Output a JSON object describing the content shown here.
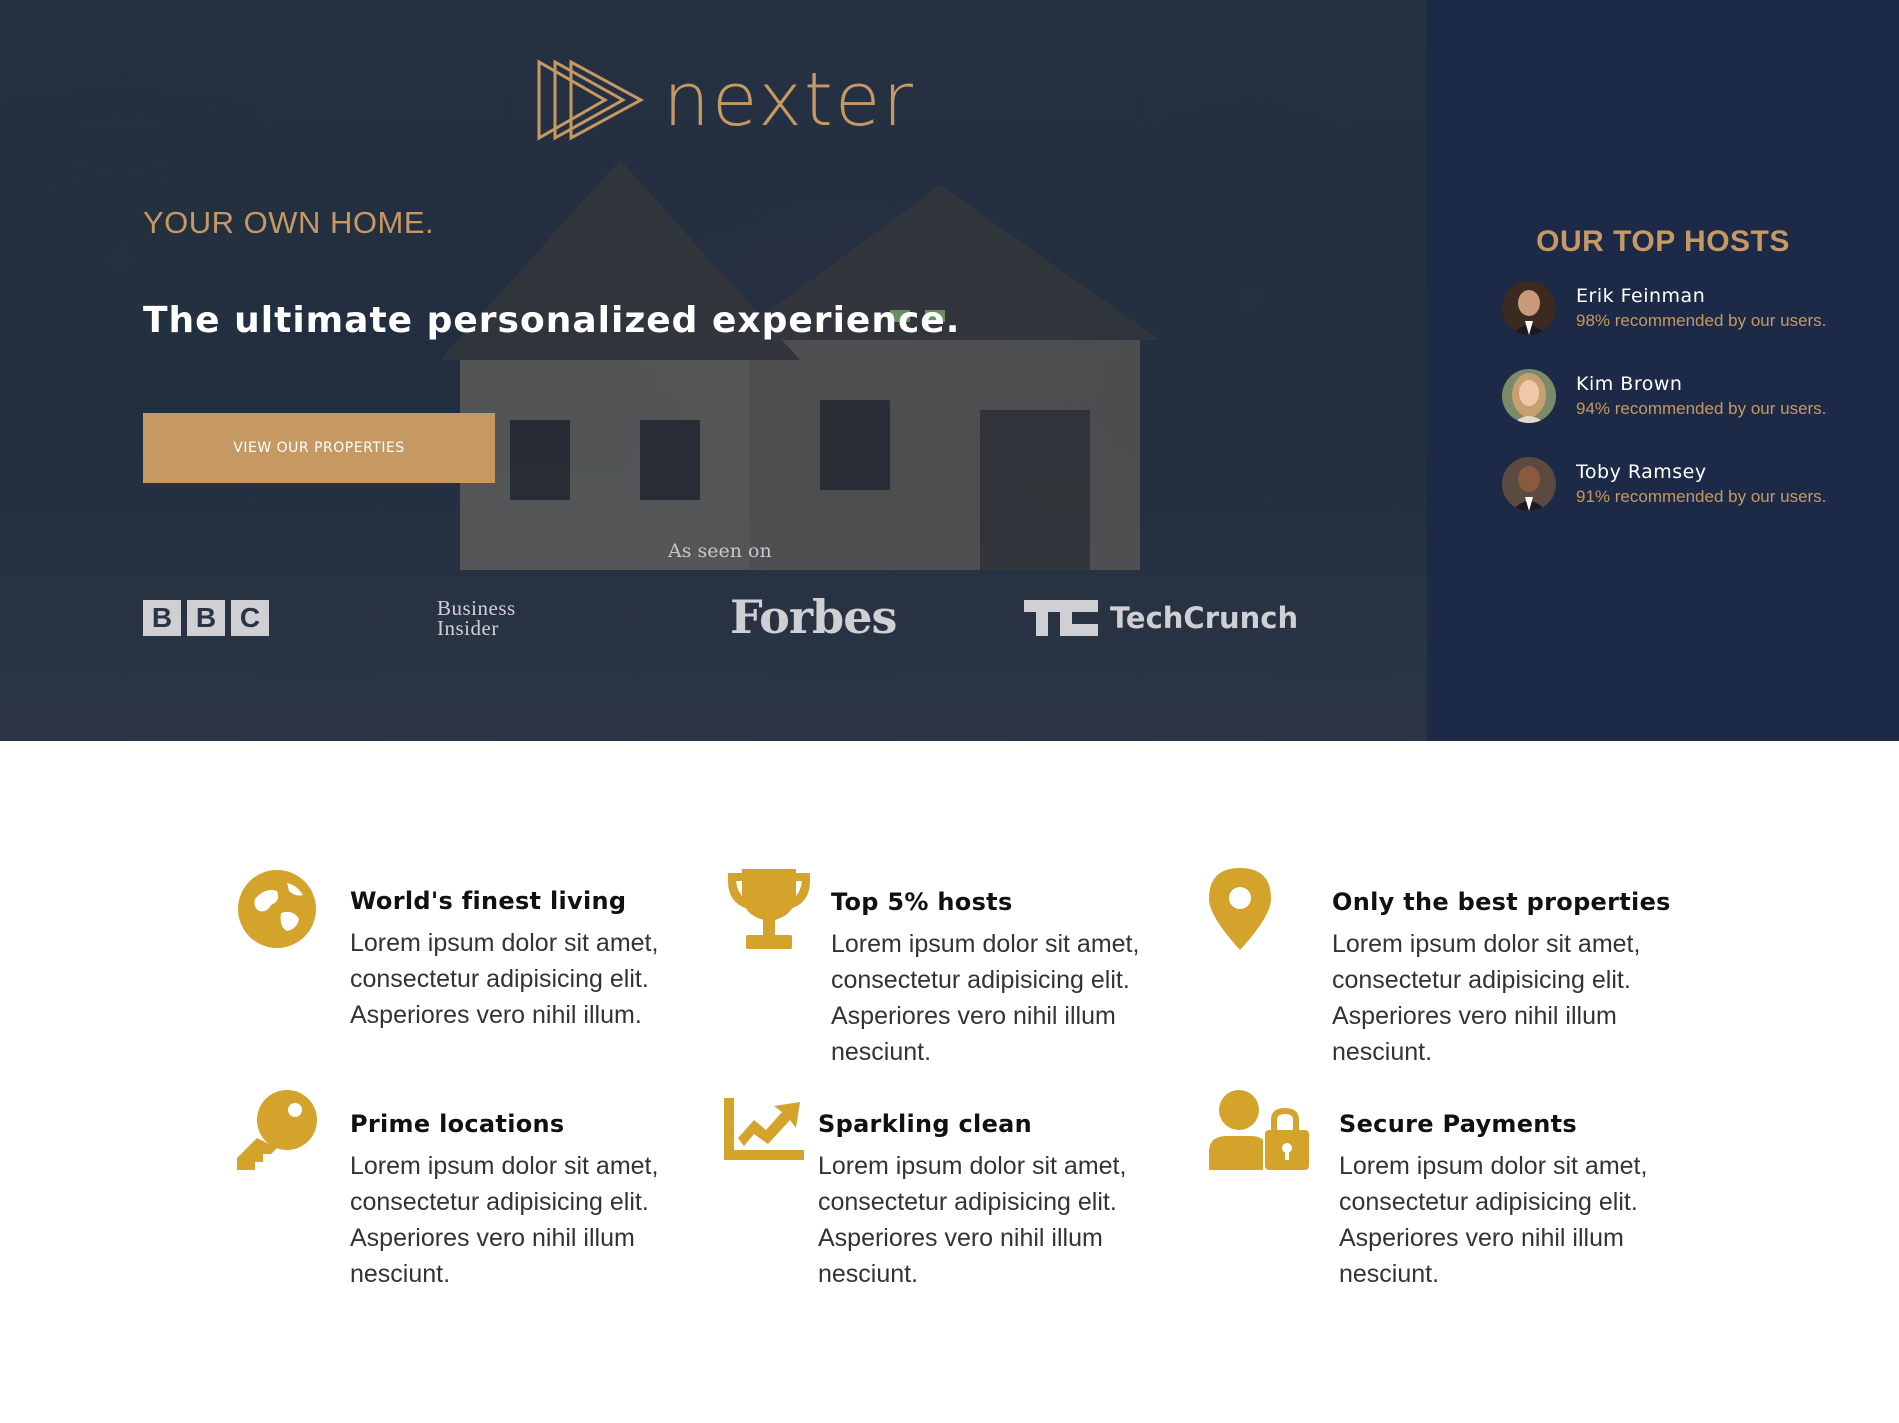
{
  "brand": {
    "name": "nexter",
    "accent": "#c69963",
    "icon_color": "#d3a32b",
    "navy": "#1c2a48"
  },
  "hero": {
    "kicker": "YOUR OWN HOME.",
    "title": "The ultimate personalized experience.",
    "cta_label": "VIEW OUR PROPERTIES",
    "seen_on": "As seen on",
    "press": {
      "bbc": [
        "B",
        "B",
        "C"
      ],
      "business_insider_line1": "Business",
      "business_insider_line2": "Insider",
      "forbes": "Forbes",
      "techcrunch": "TechCrunch"
    }
  },
  "hosts": {
    "title": "OUR TOP HOSTS",
    "items": [
      {
        "name": "Erik Feinman",
        "stat": "98% recommended by our users."
      },
      {
        "name": "Kim Brown",
        "stat": "94% recommended by our users."
      },
      {
        "name": "Toby Ramsey",
        "stat": "91% recommended by our users."
      }
    ]
  },
  "features": [
    {
      "icon": "globe-icon",
      "title": "World's finest living",
      "lines": [
        "Lorem ipsum dolor sit amet,",
        "consectetur adipisicing elit.",
        "Asperiores vero nihil illum."
      ]
    },
    {
      "icon": "trophy-icon",
      "title": "Top 5% hosts",
      "lines": [
        "Lorem ipsum dolor sit amet,",
        "consectetur adipisicing elit.",
        "Asperiores vero nihil illum",
        "nesciunt."
      ]
    },
    {
      "icon": "map-pin-icon",
      "title": "Only the best properties",
      "lines": [
        "Lorem ipsum dolor sit amet,",
        "consectetur adipisicing elit.",
        "Asperiores vero nihil illum",
        "nesciunt."
      ]
    },
    {
      "icon": "key-icon",
      "title": "Prime locations",
      "lines": [
        "Lorem ipsum dolor sit amet,",
        "consectetur adipisicing elit.",
        "Asperiores vero nihil illum",
        "nesciunt."
      ]
    },
    {
      "icon": "chart-line-icon",
      "title": "Sparkling clean",
      "lines": [
        "Lorem ipsum dolor sit amet,",
        "consectetur adipisicing elit.",
        "Asperiores vero nihil illum",
        "nesciunt."
      ]
    },
    {
      "icon": "user-lock-icon",
      "title": "Secure Payments",
      "lines": [
        "Lorem ipsum dolor sit amet,",
        "consectetur adipisicing elit.",
        "Asperiores vero nihil illum",
        "nesciunt."
      ]
    }
  ]
}
